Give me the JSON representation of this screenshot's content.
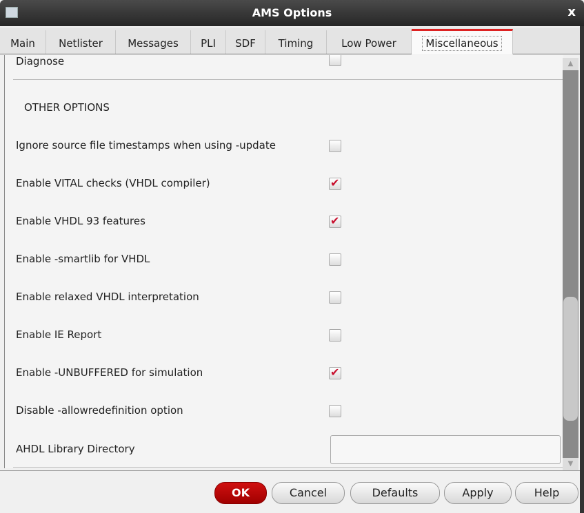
{
  "window": {
    "title": "AMS Options",
    "close_label": "x"
  },
  "tabs": [
    "Main",
    "Netlister",
    "Messages",
    "PLI",
    "SDF",
    "Timing",
    "Low Power",
    "Miscellaneous"
  ],
  "active_tab": "Miscellaneous",
  "content": {
    "diagnose": {
      "label": "Diagnose",
      "checked": false
    },
    "section_title": "OTHER OPTIONS",
    "options": [
      {
        "label": "Ignore source file timestamps when using -update",
        "checked": false
      },
      {
        "label": "Enable VITAL checks (VHDL compiler)",
        "checked": true
      },
      {
        "label": "Enable VHDL 93 features",
        "checked": true
      },
      {
        "label": "Enable -smartlib for VHDL",
        "checked": false
      },
      {
        "label": "Enable relaxed VHDL interpretation",
        "checked": false
      },
      {
        "label": "Enable IE Report",
        "checked": false
      },
      {
        "label": "Enable -UNBUFFERED for simulation",
        "checked": true
      },
      {
        "label": "Disable -allowredefinition option",
        "checked": false
      }
    ],
    "ahdl_label": "AHDL Library Directory",
    "ahdl_value": ""
  },
  "scroll_position": 0.86,
  "buttons": {
    "ok": "OK",
    "cancel": "Cancel",
    "defaults": "Defaults",
    "apply": "Apply",
    "help": "Help"
  },
  "colors": {
    "accent": "#c8102e"
  }
}
